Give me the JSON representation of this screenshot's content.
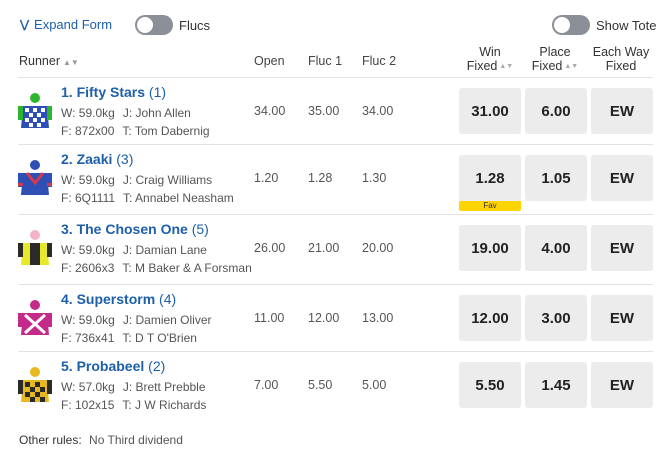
{
  "topbar": {
    "expand_label": "Expand Form",
    "flucs_label": "Flucs",
    "tote_label": "Show Tote"
  },
  "headers": {
    "runner": "Runner",
    "open": "Open",
    "fluc1": "Fluc 1",
    "fluc2": "Fluc 2",
    "win_line1": "Win",
    "win_line2": "Fixed",
    "place_line1": "Place",
    "place_line2": "Fixed",
    "ew_line1": "Each Way",
    "ew_line2": "Fixed"
  },
  "runners": [
    {
      "name": "1. Fifty Stars",
      "barrier": "(1)",
      "weight": "W: 59.0kg",
      "jockey": "J: John Allen",
      "form": "F: 872x00",
      "trainer": "T: Tom Dabernig",
      "open": "34.00",
      "fluc1": "35.00",
      "fluc2": "34.00",
      "win": "31.00",
      "place": "6.00",
      "ew": "EW",
      "fav": ""
    },
    {
      "name": "2. Zaaki",
      "barrier": "(3)",
      "weight": "W: 59.0kg",
      "jockey": "J: Craig Williams",
      "form": "F: 6Q1111",
      "trainer": "T: Annabel Neasham",
      "open": "1.20",
      "fluc1": "1.28",
      "fluc2": "1.30",
      "win": "1.28",
      "place": "1.05",
      "ew": "EW",
      "fav": "Fav"
    },
    {
      "name": "3. The Chosen One",
      "barrier": "(5)",
      "weight": "W: 59.0kg",
      "jockey": "J: Damian Lane",
      "form": "F: 2606x3",
      "trainer": "T: M Baker & A Forsman",
      "open": "26.00",
      "fluc1": "21.00",
      "fluc2": "20.00",
      "win": "19.00",
      "place": "4.00",
      "ew": "EW",
      "fav": ""
    },
    {
      "name": "4. Superstorm",
      "barrier": "(4)",
      "weight": "W: 59.0kg",
      "jockey": "J: Damien Oliver",
      "form": "F: 736x41",
      "trainer": "T: D T O'Brien",
      "open": "11.00",
      "fluc1": "12.00",
      "fluc2": "13.00",
      "win": "12.00",
      "place": "3.00",
      "ew": "EW",
      "fav": ""
    },
    {
      "name": "5. Probabeel",
      "barrier": "(2)",
      "weight": "W: 57.0kg",
      "jockey": "J: Brett Prebble",
      "form": "F: 102x15",
      "trainer": "T: J W Richards",
      "open": "7.00",
      "fluc1": "5.50",
      "fluc2": "5.00",
      "win": "5.50",
      "place": "1.45",
      "ew": "EW",
      "fav": ""
    }
  ],
  "footer": {
    "label": "Other rules:",
    "value": "No Third dividend"
  },
  "colors": {
    "link": "#1d5fa8",
    "fav_badge": "#ffd400",
    "button_bg": "#ececec"
  }
}
